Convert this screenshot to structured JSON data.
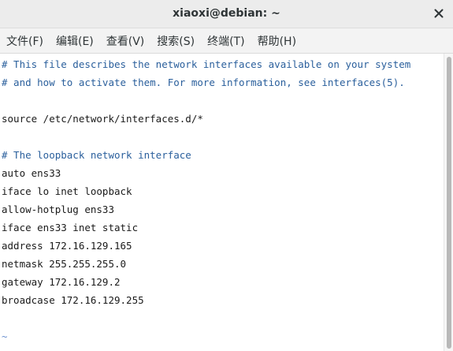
{
  "window": {
    "title": "xiaoxi@debian: ~"
  },
  "menu": [
    {
      "label": "文件(F)"
    },
    {
      "label": "编辑(E)"
    },
    {
      "label": "查看(V)"
    },
    {
      "label": "搜索(S)"
    },
    {
      "label": "终端(T)"
    },
    {
      "label": "帮助(H)"
    }
  ],
  "terminal": {
    "lines": [
      "# This file describes the network interfaces available on your system",
      "# and how to activate them. For more information, see interfaces(5).",
      "",
      "source /etc/network/interfaces.d/*",
      "",
      "# The loopback network interface",
      "auto ens33",
      "iface lo inet loopback",
      "allow-hotplug ens33",
      "iface ens33 inet static",
      "address 172.16.129.165",
      "netmask 255.255.255.0",
      "gateway 172.16.129.2",
      "broadcase 172.16.129.255",
      "",
      "~"
    ]
  },
  "colors": {
    "comment": "#2a5f9c",
    "text": "#1a1a1a",
    "tilde": "#6a8fcf"
  },
  "icons": {
    "close": "close-icon"
  }
}
